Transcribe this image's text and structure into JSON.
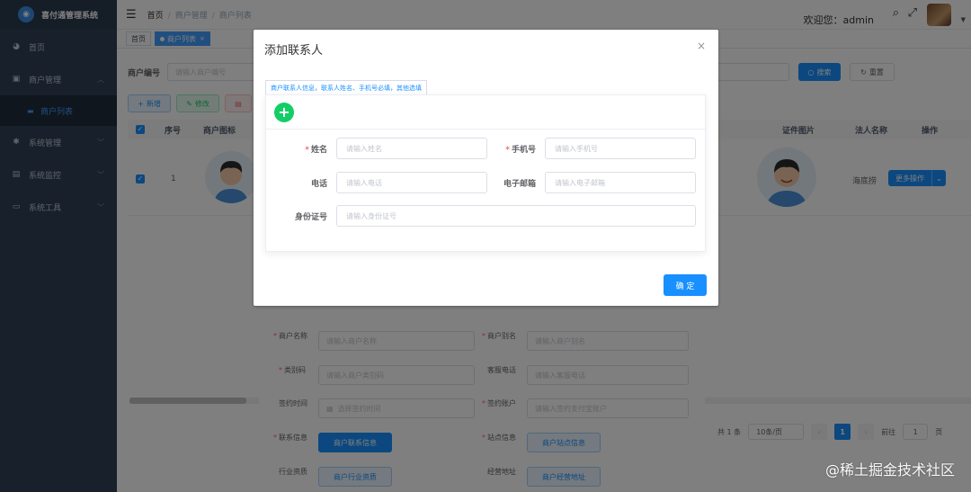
{
  "app": {
    "title": "喜付通管理系统",
    "logo_icon": "logo-icon"
  },
  "sidebar": {
    "items": [
      {
        "label": "首页",
        "icon": "dashboard-icon",
        "has_children": false
      },
      {
        "label": "商户管理",
        "icon": "store-icon",
        "has_children": true
      },
      {
        "label": "商户列表",
        "icon": "",
        "sub": true
      },
      {
        "label": "系统管理",
        "icon": "gear-icon",
        "has_children": true
      },
      {
        "label": "系统监控",
        "icon": "monitor-icon",
        "has_children": true
      },
      {
        "label": "系统工具",
        "icon": "toolbox-icon",
        "has_children": true
      }
    ]
  },
  "header": {
    "breadcrumb": [
      "首页",
      "商户管理",
      "商户列表"
    ],
    "welcome": "欢迎您：admin"
  },
  "tags": [
    {
      "label": "首页"
    },
    {
      "label": "商户列表",
      "active": true
    }
  ],
  "search": {
    "merchant_no_label": "商户编号",
    "merchant_no_placeholder": "请输入商户编号",
    "search_btn": "搜索",
    "reset_btn": "重置"
  },
  "toolbar": {
    "add_label": "新增",
    "edit_label": "修改"
  },
  "table": {
    "headers": {
      "index": "序号",
      "icon": "商户图标",
      "id_photo": "证件图片",
      "legal": "法人名称",
      "action": "操作"
    },
    "row": {
      "index": "1",
      "legal": "海底捞",
      "more_ops": "更多操作"
    }
  },
  "pagination": {
    "total": "共 1 条",
    "page_size": "10条/页",
    "current": "1",
    "goto_label": "前往",
    "goto_value": "1",
    "page_suffix": "页"
  },
  "bg_form": {
    "fields": [
      {
        "label": "商户名称",
        "placeholder": "请输入商户名称",
        "required": true
      },
      {
        "label": "商户别名",
        "placeholder": "请输入商户别名",
        "required": true
      },
      {
        "label": "类别码",
        "placeholder": "请输入商户类别码",
        "required": true
      },
      {
        "label": "客服电话",
        "placeholder": "请输入客服电话",
        "required": false
      },
      {
        "label": "签约时间",
        "placeholder": "选择签约时间",
        "required": false
      },
      {
        "label": "签约账户",
        "placeholder": "请输入签约支付宝账户",
        "required": true
      }
    ],
    "buttons": [
      {
        "label": "联系信息",
        "button": "商户联系信息",
        "required": true
      },
      {
        "label": "站点信息",
        "button": "商户站点信息",
        "required": true
      },
      {
        "label": "行业资质",
        "button": "商户行业资质",
        "required": false
      },
      {
        "label": "经营地址",
        "button": "商户经营地址",
        "required": false
      }
    ]
  },
  "modal": {
    "title": "添加联系人",
    "tab_label": "商户联系人信息，联系人姓名、手机号必填，其他选填",
    "fields": {
      "name": {
        "label": "姓名",
        "placeholder": "请输入姓名",
        "required": true
      },
      "mobile": {
        "label": "手机号",
        "placeholder": "请输入手机号",
        "required": true
      },
      "phone": {
        "label": "电话",
        "placeholder": "请输入电话",
        "required": false
      },
      "email": {
        "label": "电子邮箱",
        "placeholder": "请输入电子邮箱",
        "required": false
      },
      "idcard": {
        "label": "身份证号",
        "placeholder": "请输入身份证号",
        "required": false
      }
    },
    "confirm": "确 定"
  },
  "watermark": "@稀土掘金技术社区",
  "colors": {
    "sidebar_bg": "#304156",
    "primary": "#1890ff",
    "add_green": "#13ce66"
  }
}
